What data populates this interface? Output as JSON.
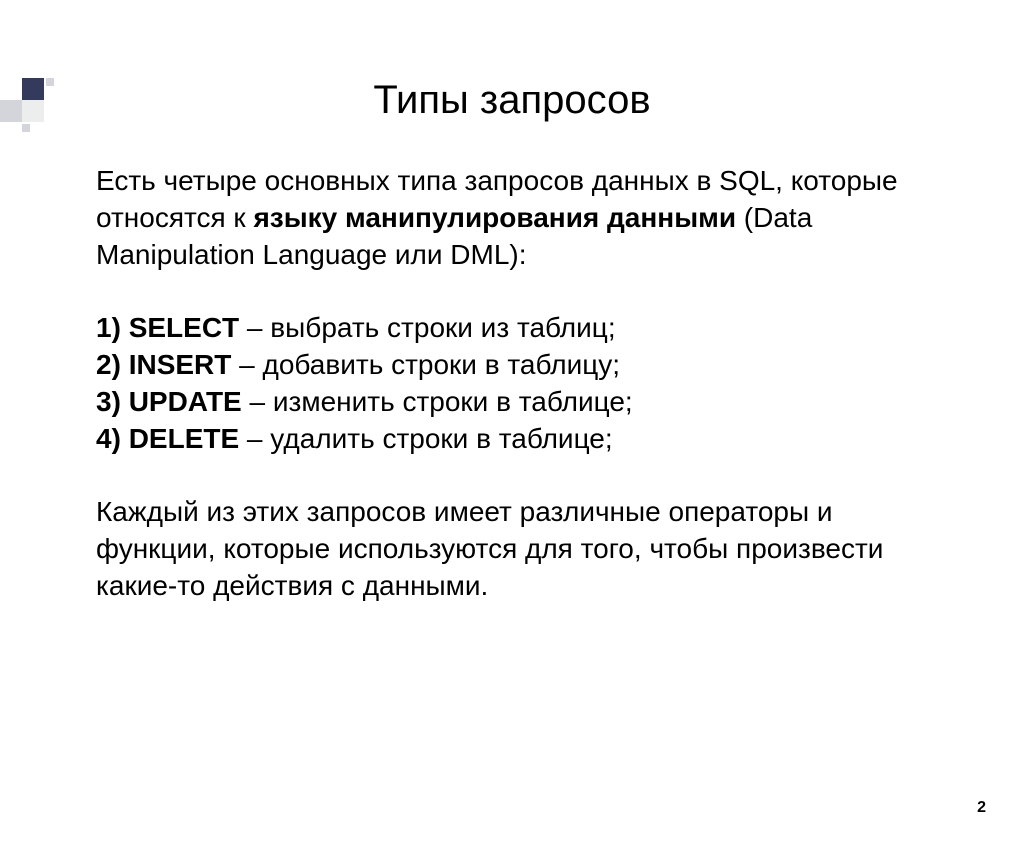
{
  "title": "Типы запросов",
  "intro": {
    "part1": "Есть четыре основных типа запросов данных в SQL, которые относятся к ",
    "bold": "языку манипулирования данными",
    "part2": " (Data Manipulation Language или DML):"
  },
  "items": [
    {
      "num": "1)",
      "cmd": "SELECT",
      "desc": " – выбрать строки из таблиц;"
    },
    {
      "num": "2)",
      "cmd": "INSERT",
      "desc": " – добавить строки в таблицу;"
    },
    {
      "num": "3)",
      "cmd": "UPDATE",
      "desc": " – изменить строки в таблице;"
    },
    {
      "num": "4)",
      "cmd": "DELETE",
      "desc": " – удалить строки в таблице;"
    }
  ],
  "outro": "Каждый из этих запросов имеет различные операторы и функции, которые используются для того, чтобы произвести какие-то действия с данными.",
  "pageNumber": "2"
}
